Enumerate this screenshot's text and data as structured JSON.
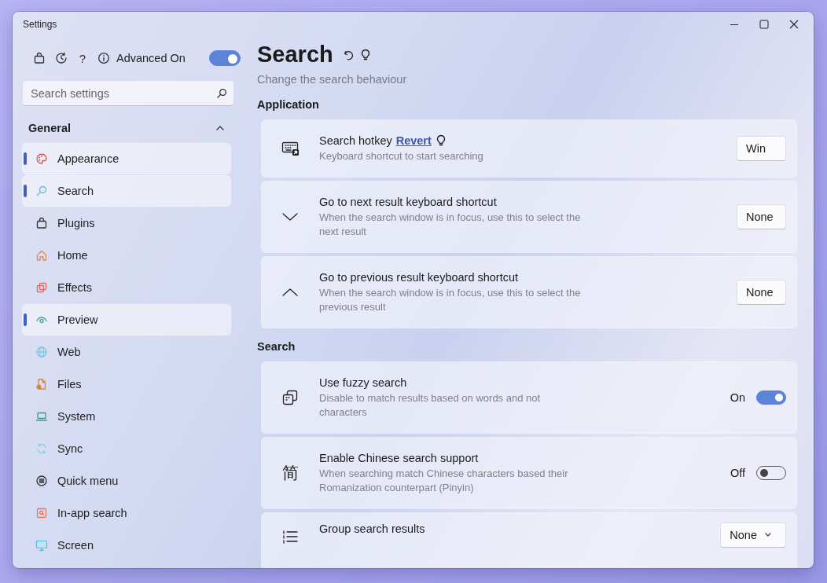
{
  "window": {
    "title": "Settings"
  },
  "sidebar": {
    "help": "?",
    "advanced": {
      "label": "Advanced On",
      "on": true
    },
    "search": {
      "placeholder": "Search settings"
    },
    "group": {
      "label": "General",
      "expanded": true
    },
    "items": [
      {
        "label": "Appearance",
        "highlighted": true
      },
      {
        "label": "Search",
        "highlighted": true
      },
      {
        "label": "Plugins",
        "highlighted": false
      },
      {
        "label": "Home",
        "highlighted": false
      },
      {
        "label": "Effects",
        "highlighted": false
      },
      {
        "label": "Preview",
        "highlighted": true
      },
      {
        "label": "Web",
        "highlighted": false
      },
      {
        "label": "Files",
        "highlighted": false
      },
      {
        "label": "System",
        "highlighted": false
      },
      {
        "label": "Sync",
        "highlighted": false
      },
      {
        "label": "Quick menu",
        "highlighted": false
      },
      {
        "label": "In-app search",
        "highlighted": false
      },
      {
        "label": "Screen",
        "highlighted": false
      }
    ]
  },
  "page": {
    "title": "Search",
    "subtitle": "Change the search behaviour",
    "sections": [
      {
        "title": "Application",
        "settings": [
          {
            "kind": "key",
            "title": "Search hotkey",
            "link": "Revert",
            "hint": true,
            "description": "Keyboard shortcut to start searching",
            "value": "Win"
          },
          {
            "kind": "key",
            "title": "Go to next result keyboard shortcut",
            "description": "When the search window is in focus, use this to select the next result",
            "value": "None"
          },
          {
            "kind": "key",
            "title": "Go to previous result keyboard shortcut",
            "description": "When the search window is in focus, use this to select the previous result",
            "value": "None"
          }
        ]
      },
      {
        "title": "Search",
        "settings": [
          {
            "kind": "toggle",
            "title": "Use fuzzy search",
            "description": "Disable to match results based on words and not characters",
            "state_label": "On",
            "on": true
          },
          {
            "kind": "toggle",
            "glyph": "简",
            "title": "Enable Chinese search support",
            "description": "When searching match Chinese characters based their Romanization counterpart (Pinyin)",
            "state_label": "Off",
            "on": false
          },
          {
            "kind": "dropdown",
            "title": "Group search results",
            "value": "None"
          }
        ]
      }
    ]
  }
}
